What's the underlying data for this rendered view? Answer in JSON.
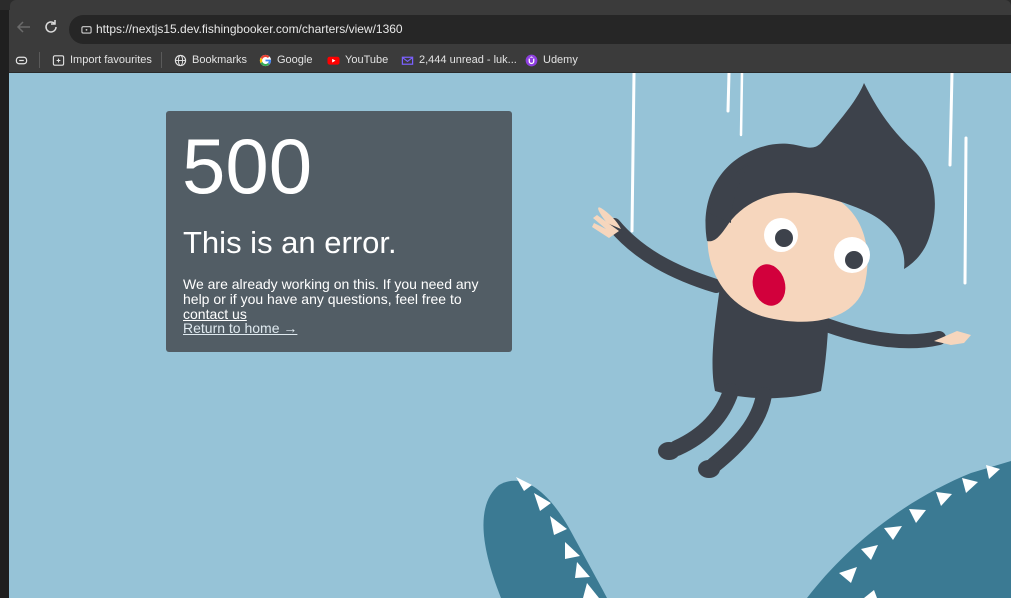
{
  "browser": {
    "url": "https://nextjs15.dev.fishingbooker.com/charters/view/1360",
    "bookmarks": [
      {
        "label": "Import favourites",
        "icon": "import-icon"
      },
      {
        "label": "Bookmarks",
        "icon": "globe-icon"
      },
      {
        "label": "Google",
        "icon": "google-icon"
      },
      {
        "label": "YouTube",
        "icon": "youtube-icon"
      },
      {
        "label": "2,444 unread - luk...",
        "icon": "mail-icon"
      },
      {
        "label": "Udemy",
        "icon": "udemy-icon"
      }
    ]
  },
  "error": {
    "code": "500",
    "title": "This is an error.",
    "message": "We are already working on this. If you need any help or if you have any questions, feel free to",
    "contact_link": "contact us",
    "home_link": "Return to home →"
  },
  "colors": {
    "page_background": "#96c3d7",
    "card_background": "#525d65",
    "shark": "#3b7a93",
    "character_dark": "#3d424b",
    "skin": "#f6d6bd",
    "mouth": "#d2003c"
  }
}
